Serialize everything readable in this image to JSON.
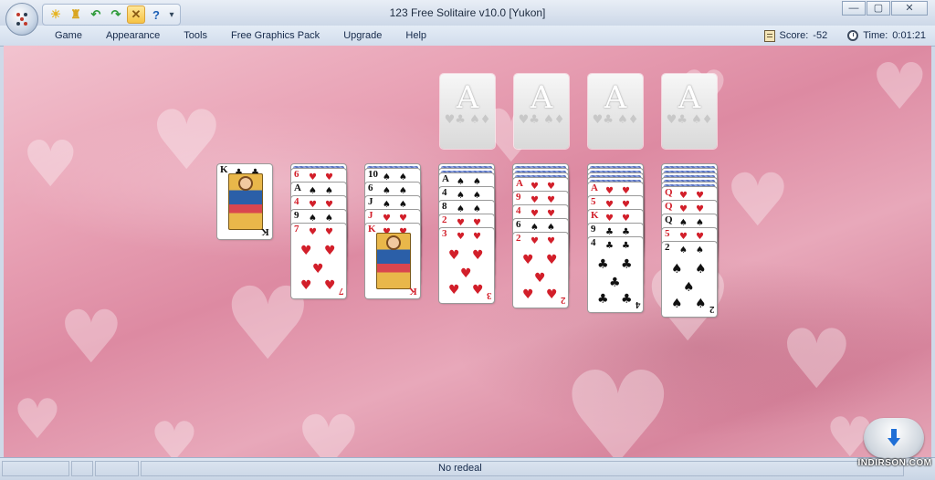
{
  "window": {
    "title": "123 Free Solitaire v10.0  [Yukon]",
    "buttons": {
      "minimize": "—",
      "maximize": "▢",
      "close": "✕"
    }
  },
  "quick_access": [
    {
      "icon": "sun-icon",
      "glyph": "☀",
      "color": "#e6b422"
    },
    {
      "icon": "trophy-icon",
      "glyph": "♜",
      "color": "#d9a521"
    },
    {
      "icon": "undo-icon",
      "glyph": "↶",
      "color": "#2e9a3a"
    },
    {
      "icon": "redo-icon",
      "glyph": "↷",
      "color": "#2e9a3a"
    },
    {
      "icon": "tools-icon",
      "glyph": "✕",
      "color": "#8a5a14"
    },
    {
      "icon": "help-icon",
      "glyph": "?",
      "color": "#1b5fb6"
    }
  ],
  "menu": [
    "Game",
    "Appearance",
    "Tools",
    "Free Graphics Pack",
    "Upgrade",
    "Help"
  ],
  "stats": {
    "score_label": "Score:",
    "score_value": "-52",
    "time_label": "Time:",
    "time_value": "0:01:21"
  },
  "foundations": [
    {
      "letter": "A",
      "suits": "♥♣ ♠♦"
    },
    {
      "letter": "A",
      "suits": "♥♣ ♠♦"
    },
    {
      "letter": "A",
      "suits": "♥♣ ♠♦"
    },
    {
      "letter": "A",
      "suits": "♥♣ ♠♦"
    }
  ],
  "tableau": [
    {
      "down": 0,
      "up": [
        {
          "rank": "K",
          "suit": "♣",
          "color": "blk",
          "face": true
        }
      ]
    },
    {
      "down": 1,
      "up": [
        {
          "rank": "6",
          "suit": "♥",
          "color": "red"
        },
        {
          "rank": "A",
          "suit": "♠",
          "color": "blk"
        },
        {
          "rank": "4",
          "suit": "♥",
          "color": "red"
        },
        {
          "rank": "9",
          "suit": "♠",
          "color": "blk"
        },
        {
          "rank": "7",
          "suit": "♥",
          "color": "red"
        }
      ]
    },
    {
      "down": 1,
      "up": [
        {
          "rank": "10",
          "suit": "♠",
          "color": "blk"
        },
        {
          "rank": "6",
          "suit": "♠",
          "color": "blk"
        },
        {
          "rank": "J",
          "suit": "♠",
          "color": "blk"
        },
        {
          "rank": "J",
          "suit": "♥",
          "color": "red"
        },
        {
          "rank": "K",
          "suit": "♥",
          "color": "red",
          "face": true
        }
      ]
    },
    {
      "down": 2,
      "up": [
        {
          "rank": "A",
          "suit": "♠",
          "color": "blk"
        },
        {
          "rank": "4",
          "suit": "♠",
          "color": "blk"
        },
        {
          "rank": "8",
          "suit": "♠",
          "color": "blk"
        },
        {
          "rank": "2",
          "suit": "♥",
          "color": "red"
        },
        {
          "rank": "3",
          "suit": "♥",
          "color": "red"
        }
      ]
    },
    {
      "down": 3,
      "up": [
        {
          "rank": "A",
          "suit": "♥",
          "color": "red"
        },
        {
          "rank": "9",
          "suit": "♥",
          "color": "red"
        },
        {
          "rank": "4",
          "suit": "♥",
          "color": "red"
        },
        {
          "rank": "6",
          "suit": "♠",
          "color": "blk"
        },
        {
          "rank": "2",
          "suit": "♥",
          "color": "red"
        }
      ]
    },
    {
      "down": 4,
      "up": [
        {
          "rank": "A",
          "suit": "♥",
          "color": "red"
        },
        {
          "rank": "5",
          "suit": "♥",
          "color": "red"
        },
        {
          "rank": "K",
          "suit": "♥",
          "color": "red"
        },
        {
          "rank": "9",
          "suit": "♣",
          "color": "blk"
        },
        {
          "rank": "4",
          "suit": "♣",
          "color": "blk"
        }
      ]
    },
    {
      "down": 5,
      "up": [
        {
          "rank": "Q",
          "suit": "♥",
          "color": "red"
        },
        {
          "rank": "Q",
          "suit": "♥",
          "color": "red"
        },
        {
          "rank": "Q",
          "suit": "♠",
          "color": "blk"
        },
        {
          "rank": "5",
          "suit": "♥",
          "color": "red"
        },
        {
          "rank": "2",
          "suit": "♠",
          "color": "blk"
        }
      ]
    }
  ],
  "status": {
    "message": "No redeal"
  },
  "watermark": {
    "text": "INDIRSON.COM"
  }
}
